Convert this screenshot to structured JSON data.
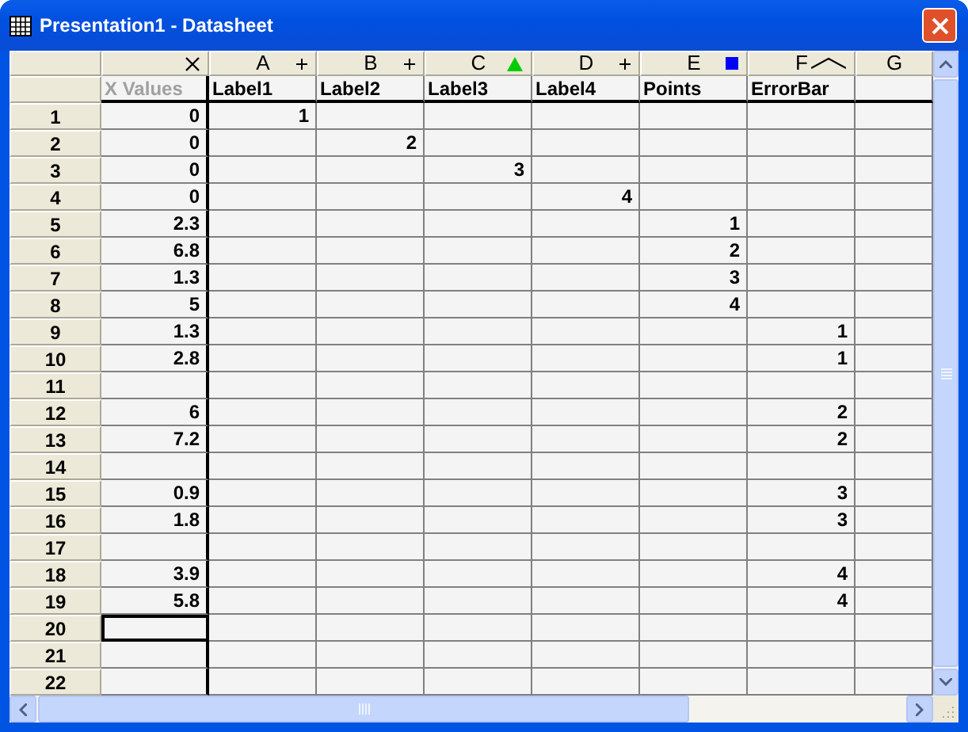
{
  "window": {
    "title": "Presentation1 - Datasheet"
  },
  "columns": [
    {
      "kind": "x",
      "label": "X Values",
      "dimmed": true
    },
    {
      "letter": "A",
      "kind": "plus",
      "label": "Label1",
      "dimmed": false
    },
    {
      "letter": "B",
      "kind": "plus",
      "label": "Label2",
      "dimmed": false
    },
    {
      "letter": "C",
      "kind": "triangle",
      "color": "#00cc00",
      "label": "Label3",
      "dimmed": false
    },
    {
      "letter": "D",
      "kind": "plus",
      "label": "Label4",
      "dimmed": false
    },
    {
      "letter": "E",
      "kind": "square",
      "color": "#0000ff",
      "label": "Points",
      "dimmed": false
    },
    {
      "letter": "F",
      "kind": "curve",
      "label": "ErrorBar",
      "dimmed": false
    },
    {
      "letter": "G"
    }
  ],
  "rows": [
    {
      "header": "1",
      "selected": false,
      "cells": [
        "0",
        "1"
      ]
    },
    {
      "header": "2",
      "selected": false,
      "cells": [
        "0",
        null,
        "2"
      ]
    },
    {
      "header": "3",
      "selected": false,
      "cells": [
        "0",
        null,
        null,
        "3"
      ]
    },
    {
      "header": "4",
      "selected": false,
      "cells": [
        "0",
        null,
        null,
        null,
        "4"
      ]
    },
    {
      "header": "5",
      "selected": false,
      "cells": [
        "2.3",
        null,
        null,
        null,
        null,
        "1"
      ]
    },
    {
      "header": "6",
      "selected": false,
      "cells": [
        "6.8",
        null,
        null,
        null,
        null,
        "2"
      ]
    },
    {
      "header": "7",
      "selected": false,
      "cells": [
        "1.3",
        null,
        null,
        null,
        null,
        "3"
      ]
    },
    {
      "header": "8",
      "selected": false,
      "cells": [
        "5",
        null,
        null,
        null,
        null,
        "4"
      ]
    },
    {
      "header": "9",
      "selected": false,
      "cells": [
        "1.3",
        null,
        null,
        null,
        null,
        null,
        "1"
      ]
    },
    {
      "header": "10",
      "selected": false,
      "cells": [
        "2.8",
        null,
        null,
        null,
        null,
        null,
        "1"
      ]
    },
    {
      "header": "11",
      "selected": false,
      "cells": []
    },
    {
      "header": "12",
      "selected": false,
      "cells": [
        "6",
        null,
        null,
        null,
        null,
        null,
        "2"
      ]
    },
    {
      "header": "13",
      "selected": false,
      "cells": [
        "7.2",
        null,
        null,
        null,
        null,
        null,
        "2"
      ]
    },
    {
      "header": "14",
      "selected": false,
      "cells": []
    },
    {
      "header": "15",
      "selected": false,
      "cells": [
        "0.9",
        null,
        null,
        null,
        null,
        null,
        "3"
      ]
    },
    {
      "header": "16",
      "selected": false,
      "cells": [
        "1.8",
        null,
        null,
        null,
        null,
        null,
        "3"
      ]
    },
    {
      "header": "17",
      "selected": false,
      "cells": []
    },
    {
      "header": "18",
      "selected": false,
      "cells": [
        "3.9",
        null,
        null,
        null,
        null,
        null,
        "4"
      ]
    },
    {
      "header": "19",
      "selected": false,
      "cells": [
        "5.8",
        null,
        null,
        null,
        null,
        null,
        "4"
      ]
    },
    {
      "header": "20",
      "selected": true,
      "cells": []
    },
    {
      "header": "21",
      "selected": false,
      "cells": []
    },
    {
      "header": "22",
      "selected": false,
      "cells": []
    }
  ]
}
